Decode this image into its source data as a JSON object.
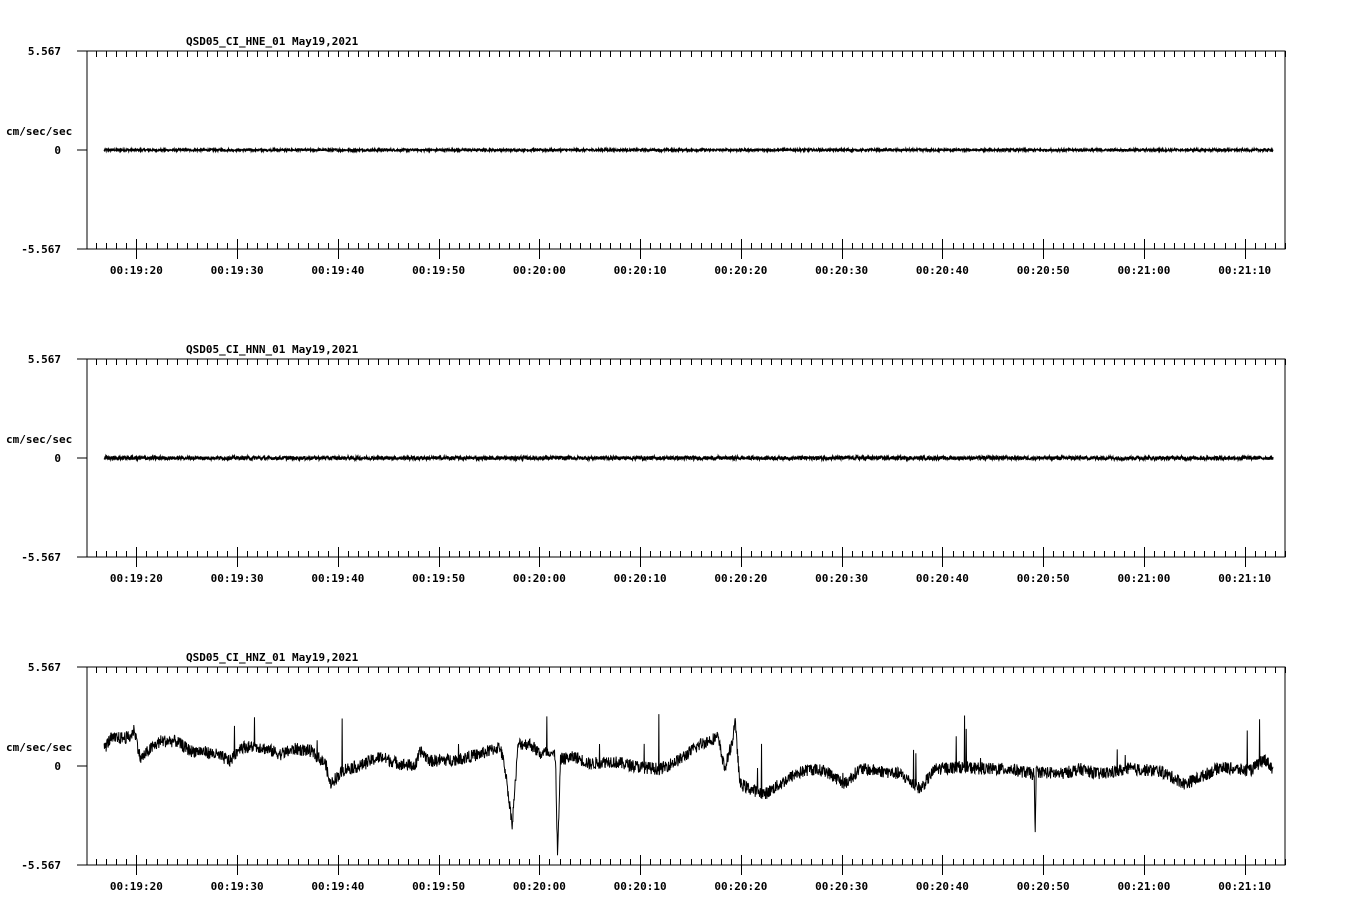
{
  "chart_data": [
    {
      "type": "line",
      "title": "QSD05_CI_HNE_01  May19,2021",
      "ylabel": "cm/sec/sec",
      "ylim": [
        -5.567,
        5.567
      ],
      "ytick_labels": [
        "5.567",
        "0",
        "-5.567"
      ],
      "xlim_seconds_after_00_19_00": [
        15.1,
        134.0
      ],
      "xtick_labels": [
        "00:19:20",
        "00:19:30",
        "00:19:40",
        "00:19:50",
        "00:20:00",
        "00:20:10",
        "00:20:20",
        "00:20:30",
        "00:20:40",
        "00:20:50",
        "00:21:00",
        "00:21:10"
      ],
      "trace_span_seconds": [
        16.8,
        132.8
      ],
      "noise_amplitude": 0.06,
      "points": [
        [
          16.8,
          0
        ],
        [
          132.8,
          0
        ]
      ]
    },
    {
      "type": "line",
      "title": "QSD05_CI_HNN_01  May19,2021",
      "ylabel": "cm/sec/sec",
      "ylim": [
        -5.567,
        5.567
      ],
      "ytick_labels": [
        "5.567",
        "0",
        "-5.567"
      ],
      "xlim_seconds_after_00_19_00": [
        15.1,
        134.0
      ],
      "xtick_labels": [
        "00:19:20",
        "00:19:30",
        "00:19:40",
        "00:19:50",
        "00:20:00",
        "00:20:10",
        "00:20:20",
        "00:20:30",
        "00:20:40",
        "00:20:50",
        "00:21:00",
        "00:21:10"
      ],
      "trace_span_seconds": [
        16.8,
        132.8
      ],
      "noise_amplitude": 0.1,
      "points": [
        [
          16.8,
          0
        ],
        [
          132.8,
          0
        ]
      ]
    },
    {
      "type": "line",
      "title": "QSD05_CI_HNZ_01  May19,2021",
      "ylabel": "cm/sec/sec",
      "ylim": [
        -5.567,
        5.567
      ],
      "ytick_labels": [
        "5.567",
        "0",
        "-5.567"
      ],
      "xlim_seconds_after_00_19_00": [
        15.1,
        134.0
      ],
      "xtick_labels": [
        "00:19:20",
        "00:19:30",
        "00:19:40",
        "00:19:50",
        "00:20:00",
        "00:20:10",
        "00:20:20",
        "00:20:30",
        "00:20:40",
        "00:20:50",
        "00:21:00",
        "00:21:10"
      ],
      "trace_span_seconds": [
        16.8,
        132.8
      ],
      "noise_amplitude": 0.35,
      "points": [
        [
          16.8,
          0.96
        ],
        [
          17.4,
          1.52
        ],
        [
          19.4,
          1.63
        ],
        [
          19.8,
          2.08
        ],
        [
          20.4,
          0.39
        ],
        [
          21.4,
          0.96
        ],
        [
          22.4,
          1.4
        ],
        [
          23.9,
          1.4
        ],
        [
          25.4,
          0.84
        ],
        [
          26.3,
          0.84
        ],
        [
          27.8,
          0.67
        ],
        [
          29.3,
          0.28
        ],
        [
          30.3,
          1.07
        ],
        [
          32.3,
          1.07
        ],
        [
          34.3,
          0.67
        ],
        [
          35.8,
          0.96
        ],
        [
          37.3,
          0.84
        ],
        [
          38.8,
          0.11
        ],
        [
          39.2,
          -1.01
        ],
        [
          40.7,
          -0.17
        ],
        [
          42.2,
          0
        ],
        [
          43.2,
          0.28
        ],
        [
          44.2,
          0.51
        ],
        [
          46.2,
          0.11
        ],
        [
          47.7,
          0
        ],
        [
          48.2,
          0.84
        ],
        [
          49.2,
          0.28
        ],
        [
          52.1,
          0.39
        ],
        [
          54.1,
          0.67
        ],
        [
          56.1,
          1.07
        ],
        [
          56.6,
          -0.17
        ],
        [
          57.1,
          -2.42
        ],
        [
          57.3,
          -3.26
        ],
        [
          57.9,
          1.24
        ],
        [
          59.1,
          1.24
        ],
        [
          60.1,
          0.67
        ],
        [
          61.1,
          0.84
        ],
        [
          61.6,
          0.5
        ],
        [
          61.8,
          -5.17
        ],
        [
          62.1,
          0.39
        ],
        [
          63.6,
          0.51
        ],
        [
          65.0,
          0.11
        ],
        [
          67.0,
          0.28
        ],
        [
          70.0,
          -0.06
        ],
        [
          72.0,
          -0.17
        ],
        [
          74.0,
          0.39
        ],
        [
          76.0,
          1.24
        ],
        [
          77.7,
          1.63
        ],
        [
          78.4,
          -0.17
        ],
        [
          79.2,
          1.5
        ],
        [
          79.4,
          2.64
        ],
        [
          79.9,
          -1.01
        ],
        [
          80.9,
          -1.29
        ],
        [
          82.4,
          -1.57
        ],
        [
          83.9,
          -1.01
        ],
        [
          85.4,
          -0.45
        ],
        [
          86.9,
          -0.17
        ],
        [
          88.4,
          -0.28
        ],
        [
          90.3,
          -1.01
        ],
        [
          91.8,
          -0.17
        ],
        [
          93.8,
          -0.28
        ],
        [
          95.8,
          -0.45
        ],
        [
          97.8,
          -1.29
        ],
        [
          99.3,
          -0.17
        ],
        [
          101.7,
          -0.06
        ],
        [
          104.7,
          -0.17
        ],
        [
          106.7,
          -0.17
        ],
        [
          109.1,
          -0.45
        ],
        [
          109.2,
          -4.1
        ],
        [
          109.3,
          -0.3
        ],
        [
          111.7,
          -0.45
        ],
        [
          113.7,
          -0.17
        ],
        [
          115.6,
          -0.45
        ],
        [
          118.6,
          -0.17
        ],
        [
          121.6,
          -0.28
        ],
        [
          124.1,
          -1.01
        ],
        [
          125.6,
          -0.62
        ],
        [
          127.6,
          -0.06
        ],
        [
          130.5,
          -0.28
        ],
        [
          132.0,
          0.39
        ],
        [
          132.8,
          -0.17
        ]
      ]
    }
  ]
}
